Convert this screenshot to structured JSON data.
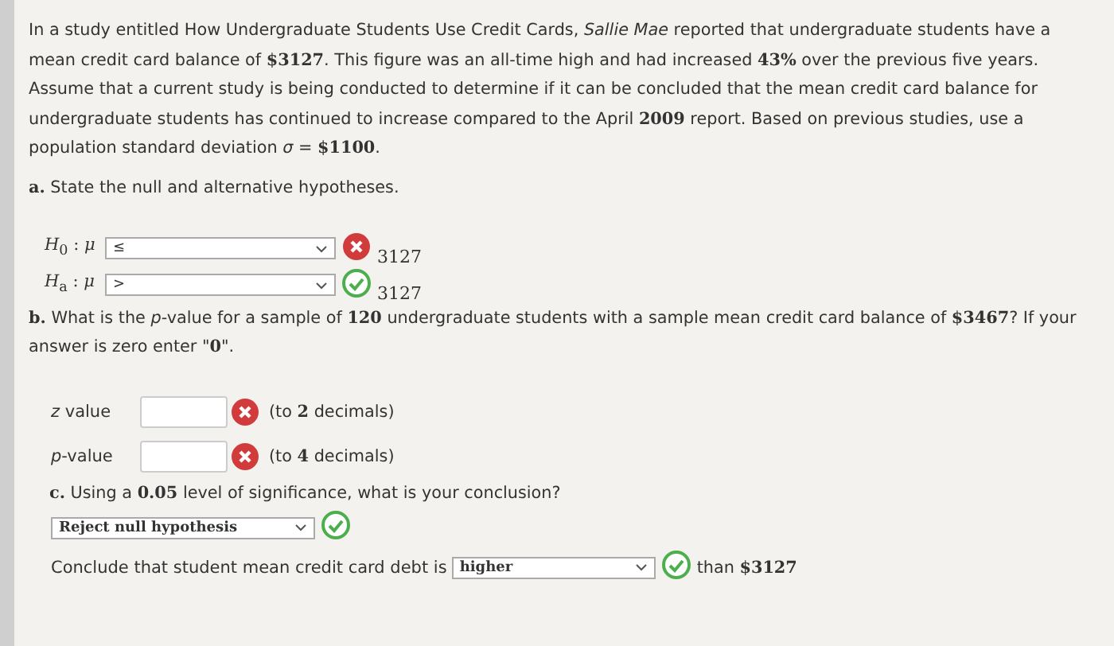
{
  "intro": "In a study entitled How Undergraduate Students Use Credit Cards, *Sallie Mae* reported that undergraduate students have a mean credit card balance of **$3127**. This figure was an all-time high and had increased **43%** over the previous five years. Assume that a current study is being conducted to determine if it can be concluded that the mean credit card balance for undergraduate students has continued to increase compared to the April **2009** report. Based on previous studies, use a population standard deviation *σ* = **$1100**.",
  "part_a": {
    "question": "**a.** State the null and alternative hypotheses.",
    "hypotheses": [
      {
        "symbol": "*H*$_{0}$ : *μ*",
        "choice": "≤",
        "correct": false,
        "value": "3127"
      },
      {
        "symbol": "*H*$_{a}$ : *μ*",
        "choice": ">",
        "correct": true,
        "value": "3127"
      }
    ]
  },
  "part_b": {
    "question": "**b.** What is the *p*-value for a sample of **120** undergraduate students with a sample mean credit card balance of **$3467**? If your answer is zero enter \"**0**\".",
    "fields": [
      {
        "label": "*z* value",
        "correct": false,
        "hint": "(to **2** decimals)"
      },
      {
        "label": "*p*-value",
        "correct": false,
        "hint": "(to **4** decimals)"
      }
    ]
  },
  "part_c": {
    "question": "**c.** Using a **0.05** level of significance, what is your conclusion?",
    "decision": {
      "choice": "Reject null hypothesis",
      "correct": true
    },
    "conclusion": {
      "prefix": "Conclude that student mean credit card debt is",
      "choice": "higher",
      "correct": true,
      "suffix": "than **$3127**"
    }
  }
}
